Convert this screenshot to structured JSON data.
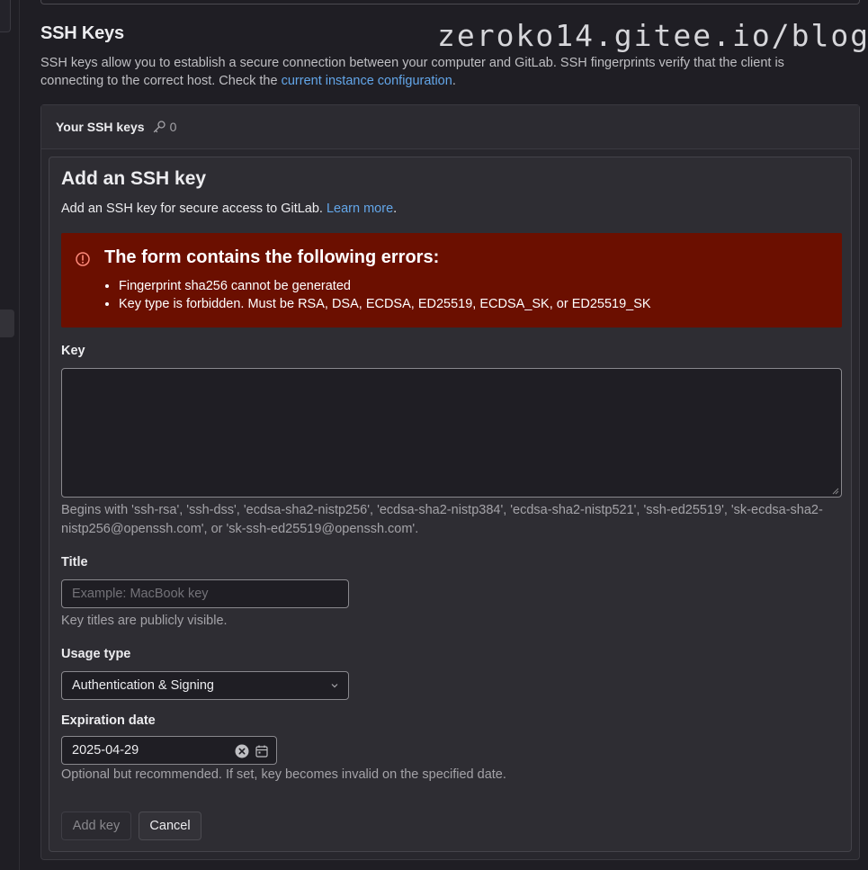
{
  "section": {
    "title": "SSH Keys",
    "description_prefix": "SSH keys allow you to establish a secure connection between your computer and GitLab. SSH fingerprints verify that the client is connecting to the correct host. Check the ",
    "description_link": "current instance configuration",
    "description_suffix": "."
  },
  "watermark": "zeroko14.gitee.io/blog/",
  "card": {
    "header_title": "Your SSH keys",
    "key_count": "0",
    "key_icon": "key-icon"
  },
  "form": {
    "title": "Add an SSH key",
    "description_prefix": "Add an SSH key for secure access to GitLab. ",
    "description_link": "Learn more",
    "description_suffix": ".",
    "alert": {
      "icon": "error-circle-icon",
      "title": "The form contains the following errors:",
      "errors": [
        "Fingerprint sha256 cannot be generated",
        "Key type is forbidden. Must be RSA, DSA, ECDSA, ED25519, ECDSA_SK, or ED25519_SK"
      ],
      "color": "#6b0f00"
    },
    "key": {
      "label": "Key",
      "value": "",
      "help": "Begins with 'ssh-rsa', 'ssh-dss', 'ecdsa-sha2-nistp256', 'ecdsa-sha2-nistp384', 'ecdsa-sha2-nistp521', 'ssh-ed25519', 'sk-ecdsa-sha2-nistp256@openssh.com', or 'sk-ssh-ed25519@openssh.com'."
    },
    "title_field": {
      "label": "Title",
      "placeholder": "Example: MacBook key",
      "help": "Key titles are publicly visible."
    },
    "usage_type": {
      "label": "Usage type",
      "selected": "Authentication & Signing"
    },
    "expiration": {
      "label": "Expiration date",
      "value": "2025-04-29",
      "help": "Optional but recommended. If set, key becomes invalid on the specified date."
    },
    "buttons": {
      "add": "Add key",
      "cancel": "Cancel"
    }
  },
  "colors": {
    "background": "#1f1e24",
    "link": "#63a6e9",
    "alert_bg": "#6b0f00"
  }
}
